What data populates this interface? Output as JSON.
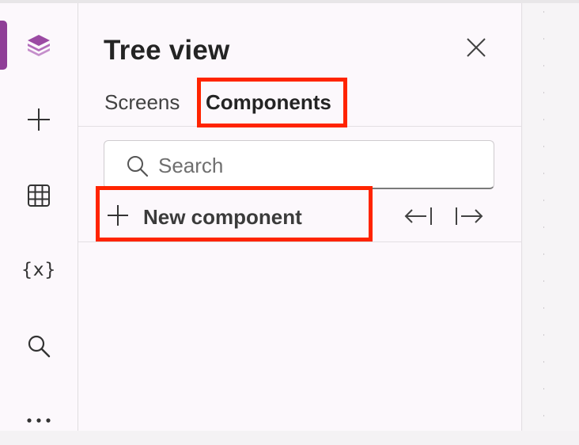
{
  "rail": {
    "items": [
      {
        "name": "tree-view",
        "icon": "layers-icon",
        "active": true
      },
      {
        "name": "insert",
        "icon": "plus-icon"
      },
      {
        "name": "data",
        "icon": "table-icon"
      },
      {
        "name": "variables",
        "icon": "variables-icon",
        "text": "{x}"
      },
      {
        "name": "search",
        "icon": "search-icon"
      },
      {
        "name": "more",
        "icon": "more-icon"
      }
    ],
    "accent_color": "#8f3f97"
  },
  "panel": {
    "title": "Tree view",
    "tabs": [
      {
        "label": "Screens",
        "selected": false
      },
      {
        "label": "Components",
        "selected": true
      }
    ],
    "search": {
      "placeholder": "Search",
      "value": ""
    },
    "new_component_label": "New component"
  },
  "highlight_color": "#ff2400"
}
